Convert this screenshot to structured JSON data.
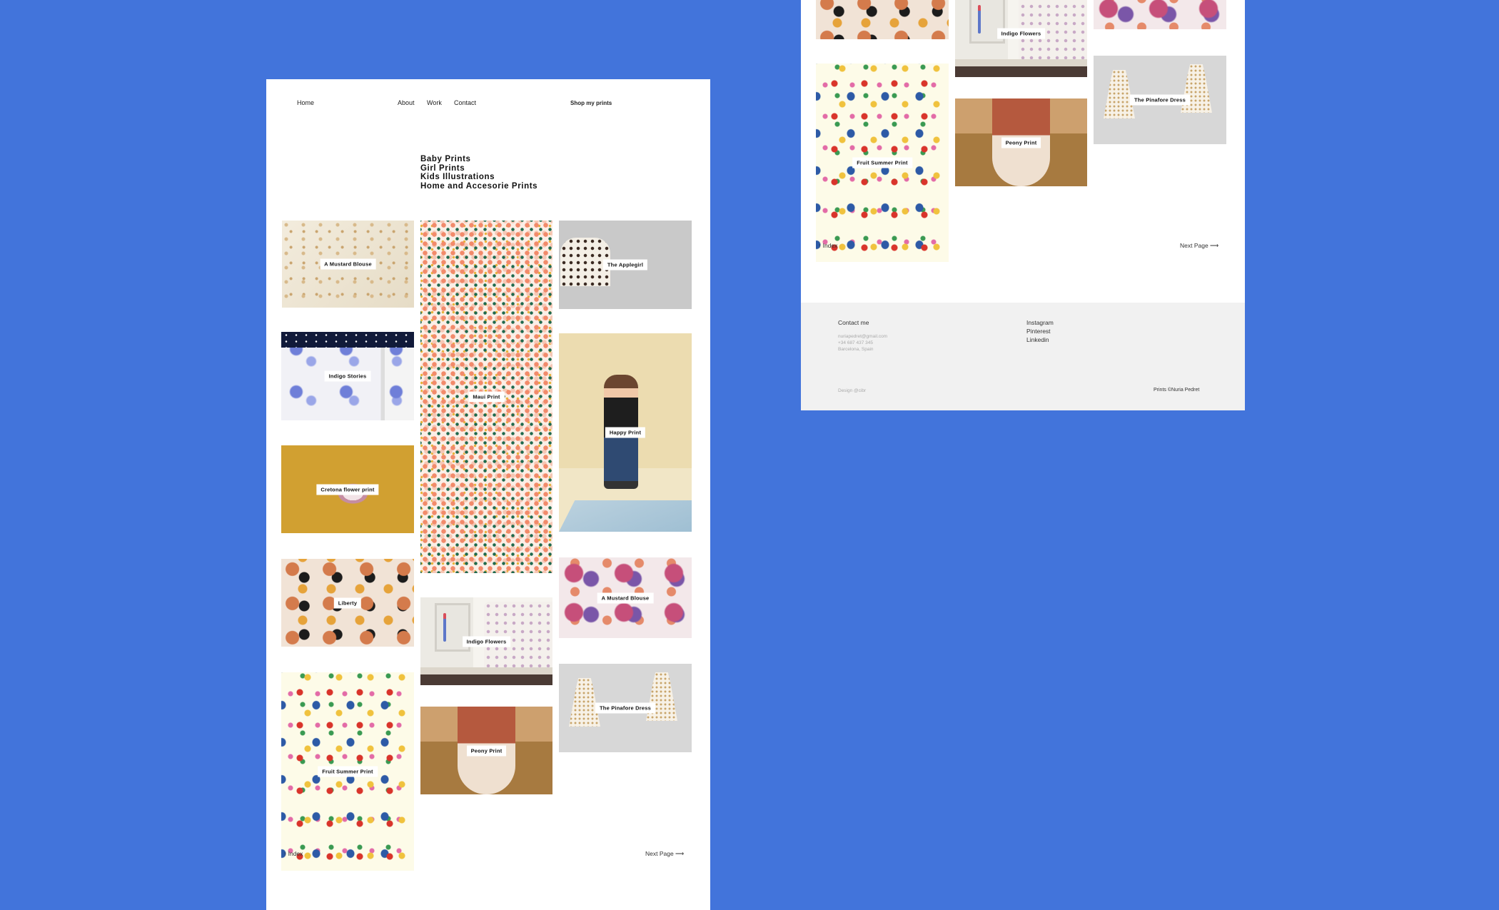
{
  "nav": {
    "home": "Home",
    "about": "About",
    "work": "Work",
    "contact": "Contact",
    "shop": "Shop my prints"
  },
  "categories": [
    "Baby Prints",
    "Girl Prints",
    "Kids Illustrations",
    "Home and Accesorie Prints"
  ],
  "tiles": {
    "mustard_blouse_1": "A Mustard Blouse",
    "indigo_stories": "Indigo Stories",
    "cretona": "Cretona flower print",
    "liberty": "Liberty",
    "fruit_summer": "Fruit Summer Print",
    "maui": "Maui Print",
    "indigo_flowers": "Indigo Flowers",
    "peony": "Peony Print",
    "applegirl": "The Applegirl",
    "happy": "Happy Print",
    "mustard_blouse_2": "A Mustard Blouse",
    "pinafore": "The Pinafore Dress"
  },
  "pagination": {
    "index": "↑ Index",
    "next": "Next Page ⟶"
  },
  "footer": {
    "contact_heading": "Contact me",
    "email": "nuriapedret@gmail.com",
    "phone": "+34 687 437 345",
    "location": "Barcelona, Spain",
    "social": [
      "Instagram",
      "Pinterest",
      "Linkedin"
    ],
    "design_credit": "Design @cibr",
    "prints_credit": "Prints ©Nuria Pedret"
  },
  "colors": {
    "background": "#4274DB",
    "page": "#ffffff",
    "footer": "#f1f1f1"
  }
}
